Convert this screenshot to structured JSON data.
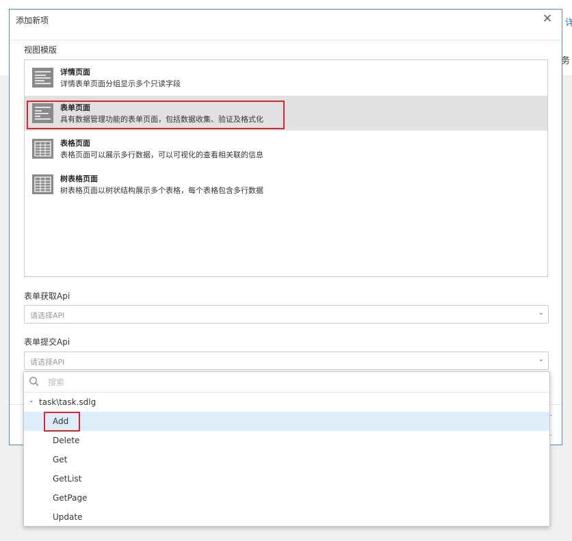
{
  "background": {
    "right_top_text": "详",
    "right_mid_text": "务"
  },
  "dialog": {
    "title": "添加新项",
    "close_glyph": "×",
    "view_template_label": "视图模版",
    "templates": [
      {
        "name": "详情页面",
        "desc": "详情表单页面分组显示多个只读字段",
        "icon": "details-page-icon",
        "selected": false
      },
      {
        "name": "表单页面",
        "desc": "具有数据管理功能的表单页面，包括数据收集、验证及格式化",
        "icon": "form-page-icon",
        "selected": true
      },
      {
        "name": "表格页面",
        "desc": "表格页面可以展示多行数据，可以可视化的查看相关联的信息",
        "icon": "table-page-icon",
        "selected": false
      },
      {
        "name": "树表格页面",
        "desc": "树表格页面以树状结构展示多个表格，每个表格包含多行数据",
        "icon": "tree-table-page-icon",
        "selected": false
      }
    ],
    "fetch_api_label": "表单获取Api",
    "fetch_api_placeholder": "请选择API",
    "submit_api_label": "表单提交Api",
    "submit_api_placeholder": "请选择API",
    "chevron": "⌄"
  },
  "dropdown": {
    "search_placeholder": "搜索",
    "group": {
      "caret": "⌄",
      "name": "task\\task.sdlg"
    },
    "items": [
      {
        "label": "Add",
        "active": true
      },
      {
        "label": "Delete",
        "active": false
      },
      {
        "label": "Get",
        "active": false
      },
      {
        "label": "GetList",
        "active": false
      },
      {
        "label": "GetPage",
        "active": false
      },
      {
        "label": "Update",
        "active": false
      }
    ]
  },
  "colors": {
    "accent_border": "#4a8bd0",
    "highlight_red": "#e0242b",
    "selected_row": "#e1e1e1",
    "active_item": "#ddeefa"
  }
}
